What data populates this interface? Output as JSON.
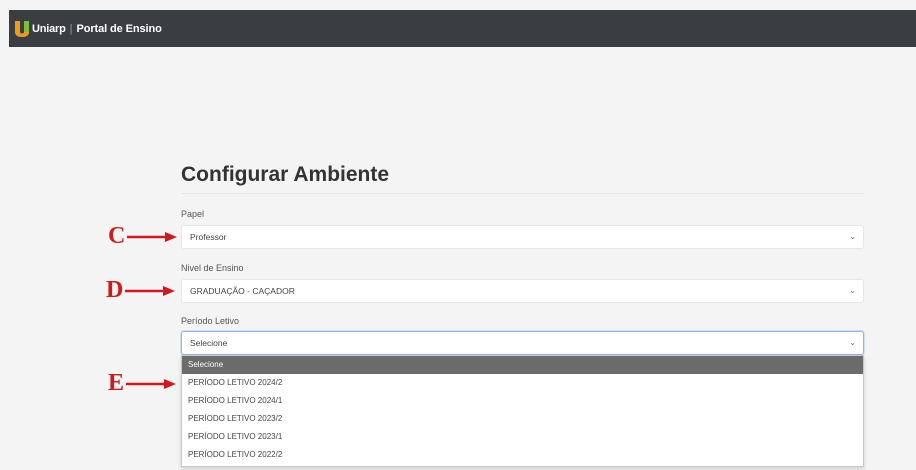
{
  "header": {
    "brand": "Uniarp",
    "divider": "|",
    "portal": "Portal de Ensino"
  },
  "form": {
    "title": "Configurar Ambiente",
    "papel": {
      "label": "Papel",
      "value": "Professor"
    },
    "nivel": {
      "label": "Nivel de Ensino",
      "value": "GRADUAÇÃO - CAÇADOR"
    },
    "periodo": {
      "label": "Período Letivo",
      "value": "Selecione"
    }
  },
  "dropdown": {
    "options": [
      "Selecione",
      "PERÍODO LETIVO 2024/2",
      "PERÍODO LETIVO 2024/1",
      "PERÍODO LETIVO 2023/2",
      "PERÍODO LETIVO 2023/1",
      "PERÍODO LETIVO 2022/2"
    ],
    "selected_index": 0
  },
  "annotations": {
    "c": "C",
    "d": "D",
    "e": "E"
  },
  "colors": {
    "header_bg": "#3a3d42",
    "logo_orange": "#f29a1e",
    "logo_green": "#7bbf3a",
    "annotation_red": "#d0191b",
    "selected_option_bg": "#6b6b6b"
  }
}
